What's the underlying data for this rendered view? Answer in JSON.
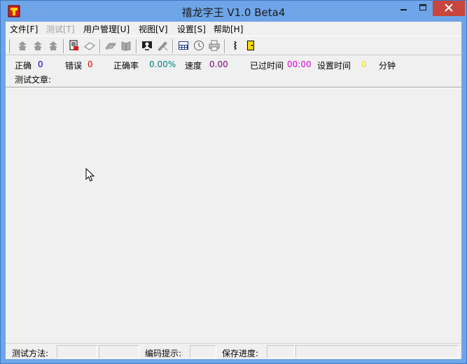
{
  "window": {
    "title": "禧龙字王 V1.0 Beta4",
    "icon": "app-logo-icon",
    "controls": {
      "minimize": "minimize-icon",
      "maximize": "maximize-icon",
      "close": "close-icon"
    }
  },
  "menu": {
    "file": "文件[F]",
    "test": "测试[T]",
    "users": "用户管理[U]",
    "view": "视图[V]",
    "settings": "设置[S]",
    "help": "帮助[H]"
  },
  "toolbar": {
    "icons": [
      "arrow-up-icon",
      "arrow-up-icon",
      "arrow-up-icon",
      "document-icon",
      "eraser-icon",
      "books-icon",
      "book-icon",
      "monitor-person-icon",
      "pen-icon",
      "calculator-icon",
      "clock-icon",
      "printer-icon",
      "info-icon",
      "exit-door-icon"
    ]
  },
  "stats": {
    "correct_label": "正确",
    "correct_value": "0",
    "error_label": "错误",
    "error_value": "0",
    "accuracy_label": "正确率",
    "accuracy_value": "0.00%",
    "speed_label": "速度",
    "speed_value": "0.00",
    "elapsed_label": "已过时间",
    "elapsed_value": "00:00",
    "set_time_label": "设置时间",
    "set_time_value": "0",
    "minute_label": "分钟",
    "article_label": "测试文章:"
  },
  "statusbar": {
    "method_label": "测试方法:",
    "hint_label": "编码提示:",
    "progress_label": "保存进度:"
  },
  "colors": {
    "title_bg": "#6ea5e8",
    "close_btn": "#c7463d",
    "client_bg": "#f0f0f0",
    "correct": "#0000c0",
    "error": "#e00000",
    "accuracy": "#008080",
    "speed": "#800080",
    "elapsed": "#e000e0",
    "set_time": "#e8e800"
  }
}
